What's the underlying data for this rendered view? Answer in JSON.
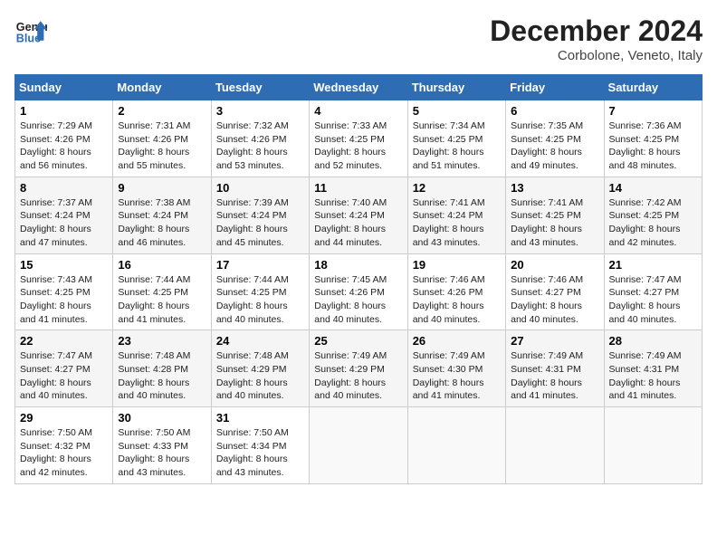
{
  "header": {
    "logo_line1": "General",
    "logo_line2": "Blue",
    "month": "December 2024",
    "location": "Corbolone, Veneto, Italy"
  },
  "weekdays": [
    "Sunday",
    "Monday",
    "Tuesday",
    "Wednesday",
    "Thursday",
    "Friday",
    "Saturday"
  ],
  "weeks": [
    [
      {
        "day": "1",
        "sunrise": "7:29 AM",
        "sunset": "4:26 PM",
        "daylight": "8 hours and 56 minutes."
      },
      {
        "day": "2",
        "sunrise": "7:31 AM",
        "sunset": "4:26 PM",
        "daylight": "8 hours and 55 minutes."
      },
      {
        "day": "3",
        "sunrise": "7:32 AM",
        "sunset": "4:26 PM",
        "daylight": "8 hours and 53 minutes."
      },
      {
        "day": "4",
        "sunrise": "7:33 AM",
        "sunset": "4:25 PM",
        "daylight": "8 hours and 52 minutes."
      },
      {
        "day": "5",
        "sunrise": "7:34 AM",
        "sunset": "4:25 PM",
        "daylight": "8 hours and 51 minutes."
      },
      {
        "day": "6",
        "sunrise": "7:35 AM",
        "sunset": "4:25 PM",
        "daylight": "8 hours and 49 minutes."
      },
      {
        "day": "7",
        "sunrise": "7:36 AM",
        "sunset": "4:25 PM",
        "daylight": "8 hours and 48 minutes."
      }
    ],
    [
      {
        "day": "8",
        "sunrise": "7:37 AM",
        "sunset": "4:24 PM",
        "daylight": "8 hours and 47 minutes."
      },
      {
        "day": "9",
        "sunrise": "7:38 AM",
        "sunset": "4:24 PM",
        "daylight": "8 hours and 46 minutes."
      },
      {
        "day": "10",
        "sunrise": "7:39 AM",
        "sunset": "4:24 PM",
        "daylight": "8 hours and 45 minutes."
      },
      {
        "day": "11",
        "sunrise": "7:40 AM",
        "sunset": "4:24 PM",
        "daylight": "8 hours and 44 minutes."
      },
      {
        "day": "12",
        "sunrise": "7:41 AM",
        "sunset": "4:24 PM",
        "daylight": "8 hours and 43 minutes."
      },
      {
        "day": "13",
        "sunrise": "7:41 AM",
        "sunset": "4:25 PM",
        "daylight": "8 hours and 43 minutes."
      },
      {
        "day": "14",
        "sunrise": "7:42 AM",
        "sunset": "4:25 PM",
        "daylight": "8 hours and 42 minutes."
      }
    ],
    [
      {
        "day": "15",
        "sunrise": "7:43 AM",
        "sunset": "4:25 PM",
        "daylight": "8 hours and 41 minutes."
      },
      {
        "day": "16",
        "sunrise": "7:44 AM",
        "sunset": "4:25 PM",
        "daylight": "8 hours and 41 minutes."
      },
      {
        "day": "17",
        "sunrise": "7:44 AM",
        "sunset": "4:25 PM",
        "daylight": "8 hours and 40 minutes."
      },
      {
        "day": "18",
        "sunrise": "7:45 AM",
        "sunset": "4:26 PM",
        "daylight": "8 hours and 40 minutes."
      },
      {
        "day": "19",
        "sunrise": "7:46 AM",
        "sunset": "4:26 PM",
        "daylight": "8 hours and 40 minutes."
      },
      {
        "day": "20",
        "sunrise": "7:46 AM",
        "sunset": "4:27 PM",
        "daylight": "8 hours and 40 minutes."
      },
      {
        "day": "21",
        "sunrise": "7:47 AM",
        "sunset": "4:27 PM",
        "daylight": "8 hours and 40 minutes."
      }
    ],
    [
      {
        "day": "22",
        "sunrise": "7:47 AM",
        "sunset": "4:27 PM",
        "daylight": "8 hours and 40 minutes."
      },
      {
        "day": "23",
        "sunrise": "7:48 AM",
        "sunset": "4:28 PM",
        "daylight": "8 hours and 40 minutes."
      },
      {
        "day": "24",
        "sunrise": "7:48 AM",
        "sunset": "4:29 PM",
        "daylight": "8 hours and 40 minutes."
      },
      {
        "day": "25",
        "sunrise": "7:49 AM",
        "sunset": "4:29 PM",
        "daylight": "8 hours and 40 minutes."
      },
      {
        "day": "26",
        "sunrise": "7:49 AM",
        "sunset": "4:30 PM",
        "daylight": "8 hours and 41 minutes."
      },
      {
        "day": "27",
        "sunrise": "7:49 AM",
        "sunset": "4:31 PM",
        "daylight": "8 hours and 41 minutes."
      },
      {
        "day": "28",
        "sunrise": "7:49 AM",
        "sunset": "4:31 PM",
        "daylight": "8 hours and 41 minutes."
      }
    ],
    [
      {
        "day": "29",
        "sunrise": "7:50 AM",
        "sunset": "4:32 PM",
        "daylight": "8 hours and 42 minutes."
      },
      {
        "day": "30",
        "sunrise": "7:50 AM",
        "sunset": "4:33 PM",
        "daylight": "8 hours and 43 minutes."
      },
      {
        "day": "31",
        "sunrise": "7:50 AM",
        "sunset": "4:34 PM",
        "daylight": "8 hours and 43 minutes."
      },
      null,
      null,
      null,
      null
    ]
  ]
}
